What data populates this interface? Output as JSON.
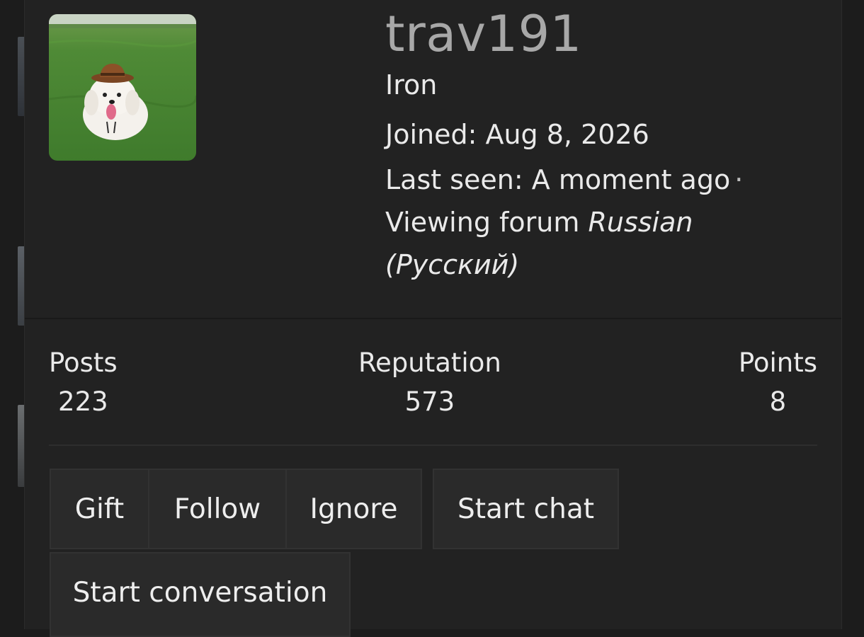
{
  "profile": {
    "username": "trav191",
    "rank": "Iron",
    "joined": "Joined: Aug 8, 2026",
    "last_seen": "Last seen: A moment ago",
    "separator": "·",
    "viewing_prefix": "Viewing forum",
    "viewing_forum": "Russian (Русский)",
    "avatar": "profile-photo-dog-in-hat"
  },
  "stats": {
    "posts_label": "Posts",
    "posts_value": "223",
    "reputation_label": "Reputation",
    "reputation_value": "573",
    "points_label": "Points",
    "points_value": "8"
  },
  "actions": {
    "gift": "Gift",
    "follow": "Follow",
    "ignore": "Ignore",
    "start_chat": "Start chat",
    "start_conversation": "Start conversation"
  }
}
